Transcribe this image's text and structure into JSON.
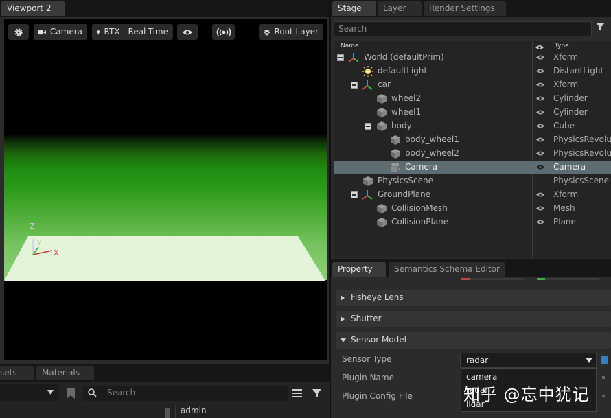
{
  "viewport": {
    "tab": "Viewport 2",
    "toolbar": {
      "camera_label": "Camera",
      "render_mode_label": "RTX - Real-Time",
      "root_layer_label": "Root Layer"
    },
    "axes": {
      "z": "Z",
      "y": "Y",
      "x": "X"
    }
  },
  "stage": {
    "tabs": [
      "Stage",
      "Layer",
      "Render Settings"
    ],
    "search_placeholder": "Search",
    "columns": {
      "name": "Name",
      "type": "Type"
    },
    "rows": [
      {
        "name": "World (defaultPrim)",
        "type": "Xform",
        "icon": "xform-icon"
      },
      {
        "name": "defaultLight",
        "type": "DistantLight",
        "icon": "light-icon"
      },
      {
        "name": "car",
        "type": "Xform",
        "icon": "xform-icon"
      },
      {
        "name": "wheel2",
        "type": "Cylinder",
        "icon": "mesh-icon"
      },
      {
        "name": "wheel1",
        "type": "Cylinder",
        "icon": "mesh-icon"
      },
      {
        "name": "body",
        "type": "Cube",
        "icon": "mesh-icon"
      },
      {
        "name": "body_wheel1",
        "type": "PhysicsRevolute",
        "icon": "mesh-icon"
      },
      {
        "name": "body_wheel2",
        "type": "PhysicsRevolute",
        "icon": "mesh-icon"
      },
      {
        "name": "Camera",
        "type": "Camera",
        "icon": "camera-icon",
        "selected": true
      },
      {
        "name": "PhysicsScene",
        "type": "PhysicsScene",
        "icon": "mesh-icon"
      },
      {
        "name": "GroundPlane",
        "type": "Xform",
        "icon": "xform-icon"
      },
      {
        "name": "CollisionMesh",
        "type": "Mesh",
        "icon": "mesh-icon"
      },
      {
        "name": "CollisionPlane",
        "type": "Plane",
        "icon": "mesh-icon"
      }
    ]
  },
  "property": {
    "tabs": [
      "Property",
      "Semantics Schema Editor"
    ],
    "sections": [
      "Fisheye Lens",
      "Shutter",
      "Sensor Model"
    ],
    "fields": {
      "sensor_type_label": "Sensor Type",
      "sensor_type_value": "radar",
      "plugin_name_label": "Plugin Name",
      "plugin_config_label": "Plugin Config File"
    },
    "dropdown_options": [
      "camera",
      "radar",
      "lidar"
    ],
    "watermark": "知乎 @忘中犹记"
  },
  "bottom_left": {
    "tabs": [
      "sets",
      "Materials"
    ],
    "search_placeholder": "Search",
    "list_item": "admin"
  },
  "colors": {
    "selection": "#5d6b73",
    "ground": "#e6f5dc",
    "sky_green": "#2d9a1c",
    "accent_blue": "#3b7bbf"
  }
}
